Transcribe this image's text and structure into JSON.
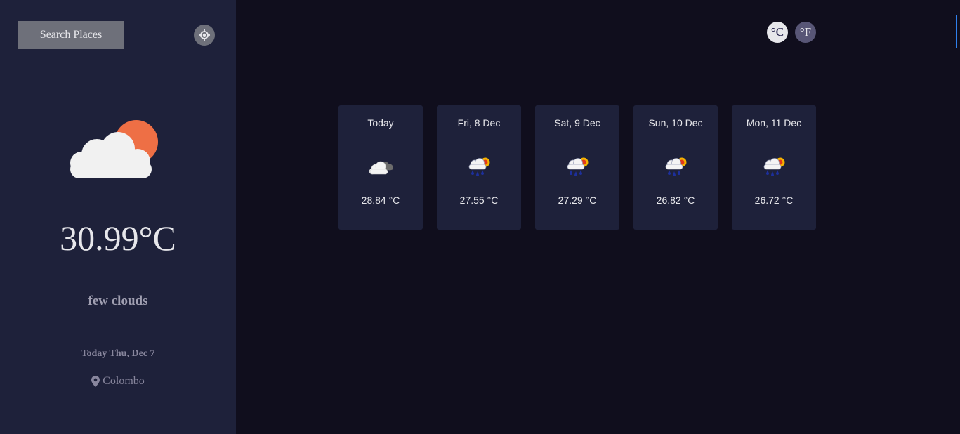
{
  "sidebar": {
    "search_label": "Search Places",
    "current": {
      "icon": "few-clouds-icon",
      "temperature": "30.99°C",
      "description": "few clouds",
      "date": "Today Thu, Dec 7",
      "location": "Colombo"
    }
  },
  "units": {
    "celsius_label": "°C",
    "fahrenheit_label": "°F",
    "selected": "celsius"
  },
  "forecast": [
    {
      "day": "Today",
      "icon": "broken-clouds-icon",
      "temp": "28.84 °C"
    },
    {
      "day": "Fri, 8 Dec",
      "icon": "rain-icon",
      "temp": "27.55 °C"
    },
    {
      "day": "Sat, 9 Dec",
      "icon": "rain-icon",
      "temp": "27.29 °C"
    },
    {
      "day": "Sun, 10 Dec",
      "icon": "rain-icon",
      "temp": "26.82 °C"
    },
    {
      "day": "Mon, 11 Dec",
      "icon": "rain-icon",
      "temp": "26.72 °C"
    }
  ],
  "colors": {
    "sidebar_bg": "#1e213a",
    "main_bg": "#100e1d",
    "card_bg": "#1e213a",
    "button_gray": "#6e707a",
    "text_light": "#e7e7eb",
    "sun_orange": "#f07a50",
    "accent_blue": "#2f80ed"
  }
}
